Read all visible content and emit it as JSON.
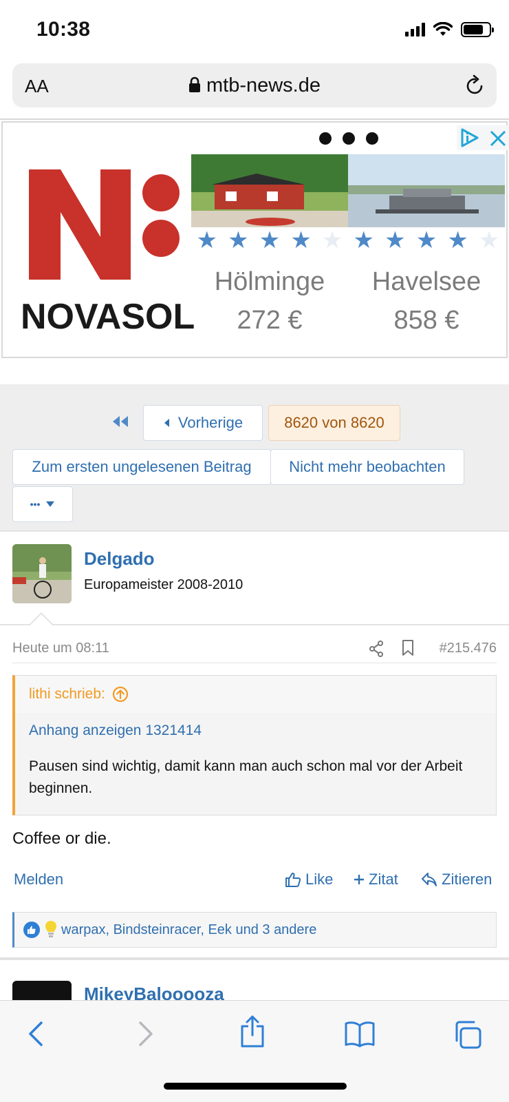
{
  "status_bar": {
    "time": "10:38"
  },
  "url_bar": {
    "text_size_button": "AA",
    "domain": "mtb-news.de"
  },
  "ad": {
    "brand": "NOVASOL",
    "offers": [
      {
        "name": "Hölminge",
        "price": "272 €",
        "rating": 4
      },
      {
        "name": "Havelsee",
        "price": "858 €",
        "rating": 4
      }
    ],
    "colors": {
      "brand_red": "#c8322a",
      "star_blue": "#4f89c7"
    }
  },
  "pagination": {
    "previous_label": "Vorherige",
    "page_info": "8620 von 8620"
  },
  "thread_actions": {
    "first_unread_label": "Zum ersten ungelesenen Beitrag",
    "unwatch_label": "Nicht mehr beobachten",
    "more_label": "•••"
  },
  "post": {
    "username": "Delgado",
    "user_title": "Europameister 2008-2010",
    "date": "Heute um 08:11",
    "number": "#215.476",
    "quote": {
      "author": "lithi schrieb:",
      "attachment": "Anhang anzeigen 1321414",
      "text": "Pausen sind wichtig, damit kann man auch schon mal vor der Arbeit beginnen."
    },
    "message": "Coffee or die.",
    "actions": {
      "report": "Melden",
      "like": "Like",
      "multi_quote": "Zitat",
      "reply": "Zitieren"
    },
    "reactions_text": "warpax, Bindsteinracer, Eek und 3 andere"
  },
  "next_post": {
    "username": "MikeyBalooooza"
  },
  "colors": {
    "link_blue": "#2f6fb0",
    "quote_orange": "#f29a23",
    "page_gray": "#eeeeee"
  }
}
